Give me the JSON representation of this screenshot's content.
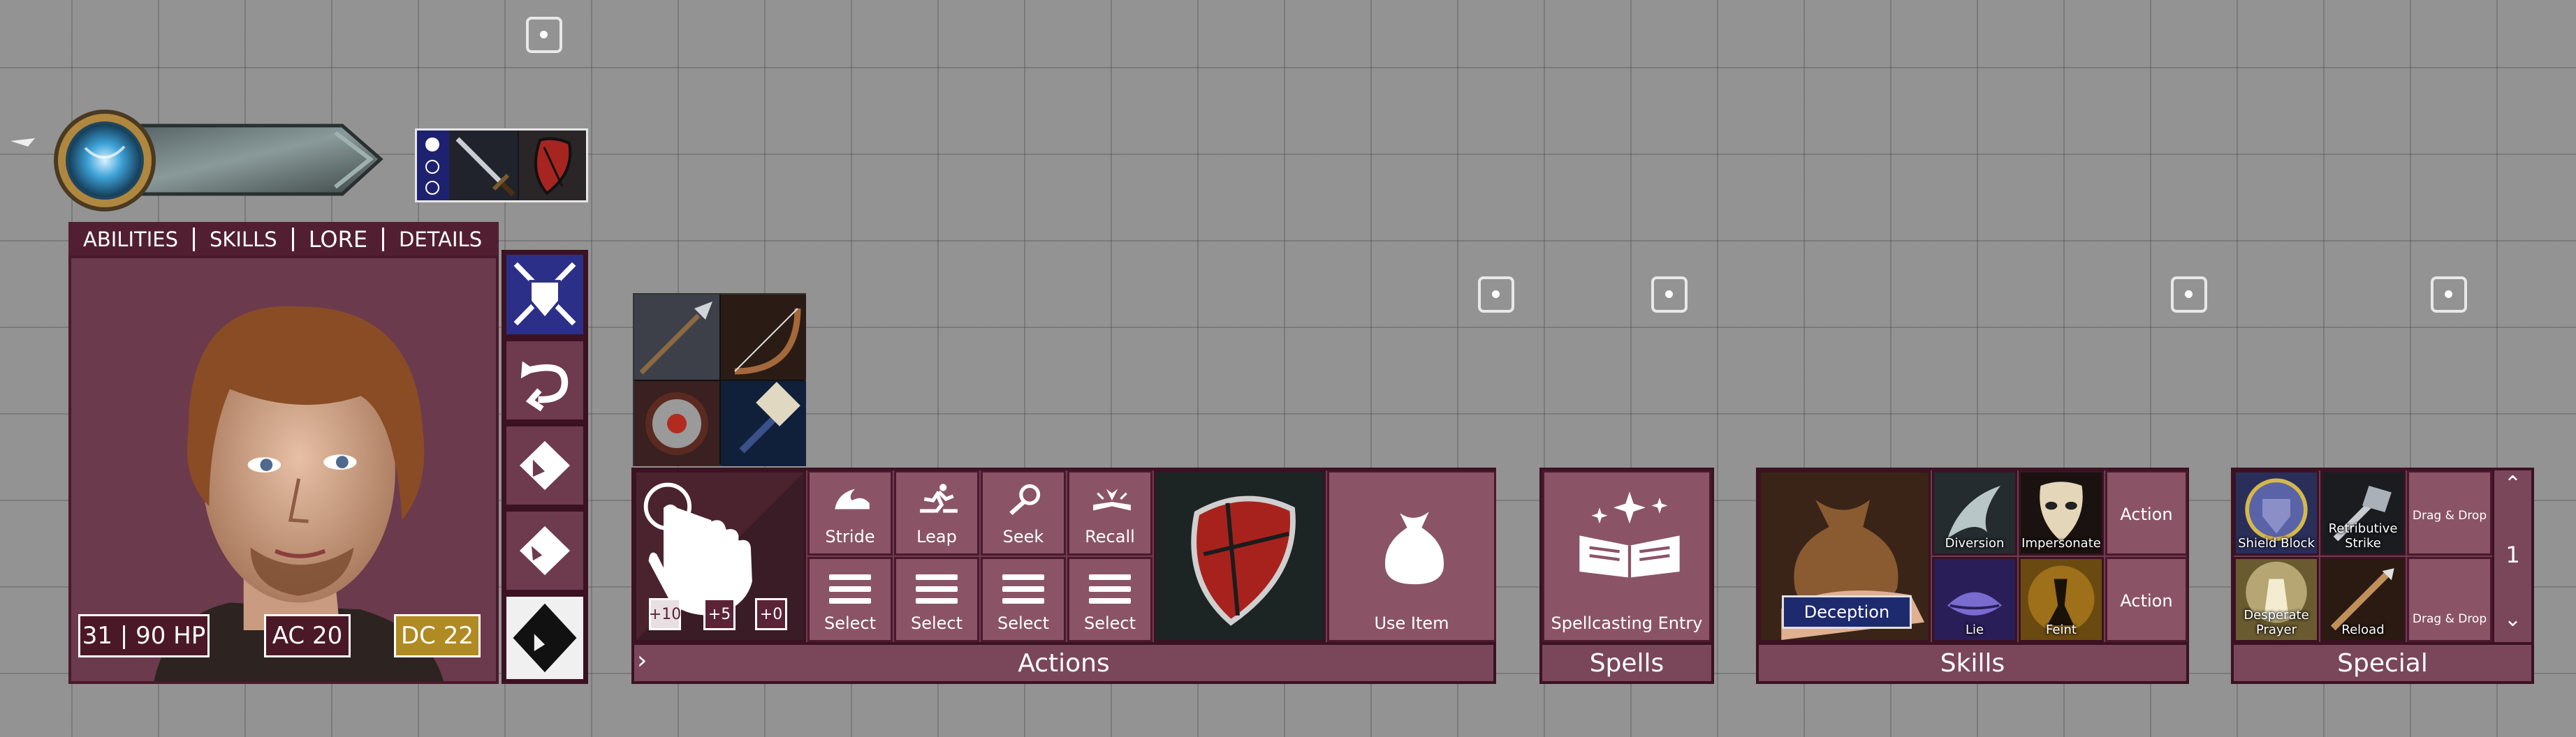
{
  "tabs": [
    "ABILITIES",
    "SKILLS",
    "LORE",
    "DETAILS"
  ],
  "stats": {
    "hp": "31 | 90 HP",
    "ac": "AC 20",
    "dc": "DC 22"
  },
  "actions": {
    "strike_mods": [
      "+10",
      "+5",
      "+0"
    ],
    "basic": [
      {
        "label": "Stride",
        "icon": "stride-icon"
      },
      {
        "label": "Leap",
        "icon": "leap-icon"
      },
      {
        "label": "Seek",
        "icon": "seek-icon"
      },
      {
        "label": "Recall",
        "icon": "recall-knowledge-icon"
      }
    ],
    "selects": [
      "Select",
      "Select",
      "Select",
      "Select"
    ],
    "use_item": "Use Item",
    "title": "Actions",
    "expand": "›"
  },
  "spells": {
    "entry": "Spellcasting Entry",
    "title": "Spells"
  },
  "skills": {
    "featured": "Deception",
    "items": [
      {
        "label": "Diversion",
        "icon": "diversion-icon"
      },
      {
        "label": "Impersonate",
        "icon": "impersonate-mask-icon"
      },
      {
        "label": "Lie",
        "icon": "lie-lips-icon"
      },
      {
        "label": "Feint",
        "icon": "feint-icon"
      }
    ],
    "actions": [
      "Action",
      "Action"
    ],
    "title": "Skills"
  },
  "special": {
    "items": [
      {
        "label": "Shield Block",
        "icon": "shield-block-icon"
      },
      {
        "label": "Retributive Strike",
        "icon": "retributive-strike-icon"
      },
      {
        "label": "Desperate Prayer",
        "icon": "desperate-prayer-icon"
      },
      {
        "label": "Reload",
        "icon": "reload-icon"
      }
    ],
    "drag_drop": [
      "Drag & Drop",
      "Drag & Drop"
    ],
    "page": "1",
    "title": "Special"
  },
  "colors": {
    "panel": "#6e3d51",
    "border": "#3b1222",
    "tabbar": "#511f31",
    "dc_badge": "#b08a22"
  }
}
